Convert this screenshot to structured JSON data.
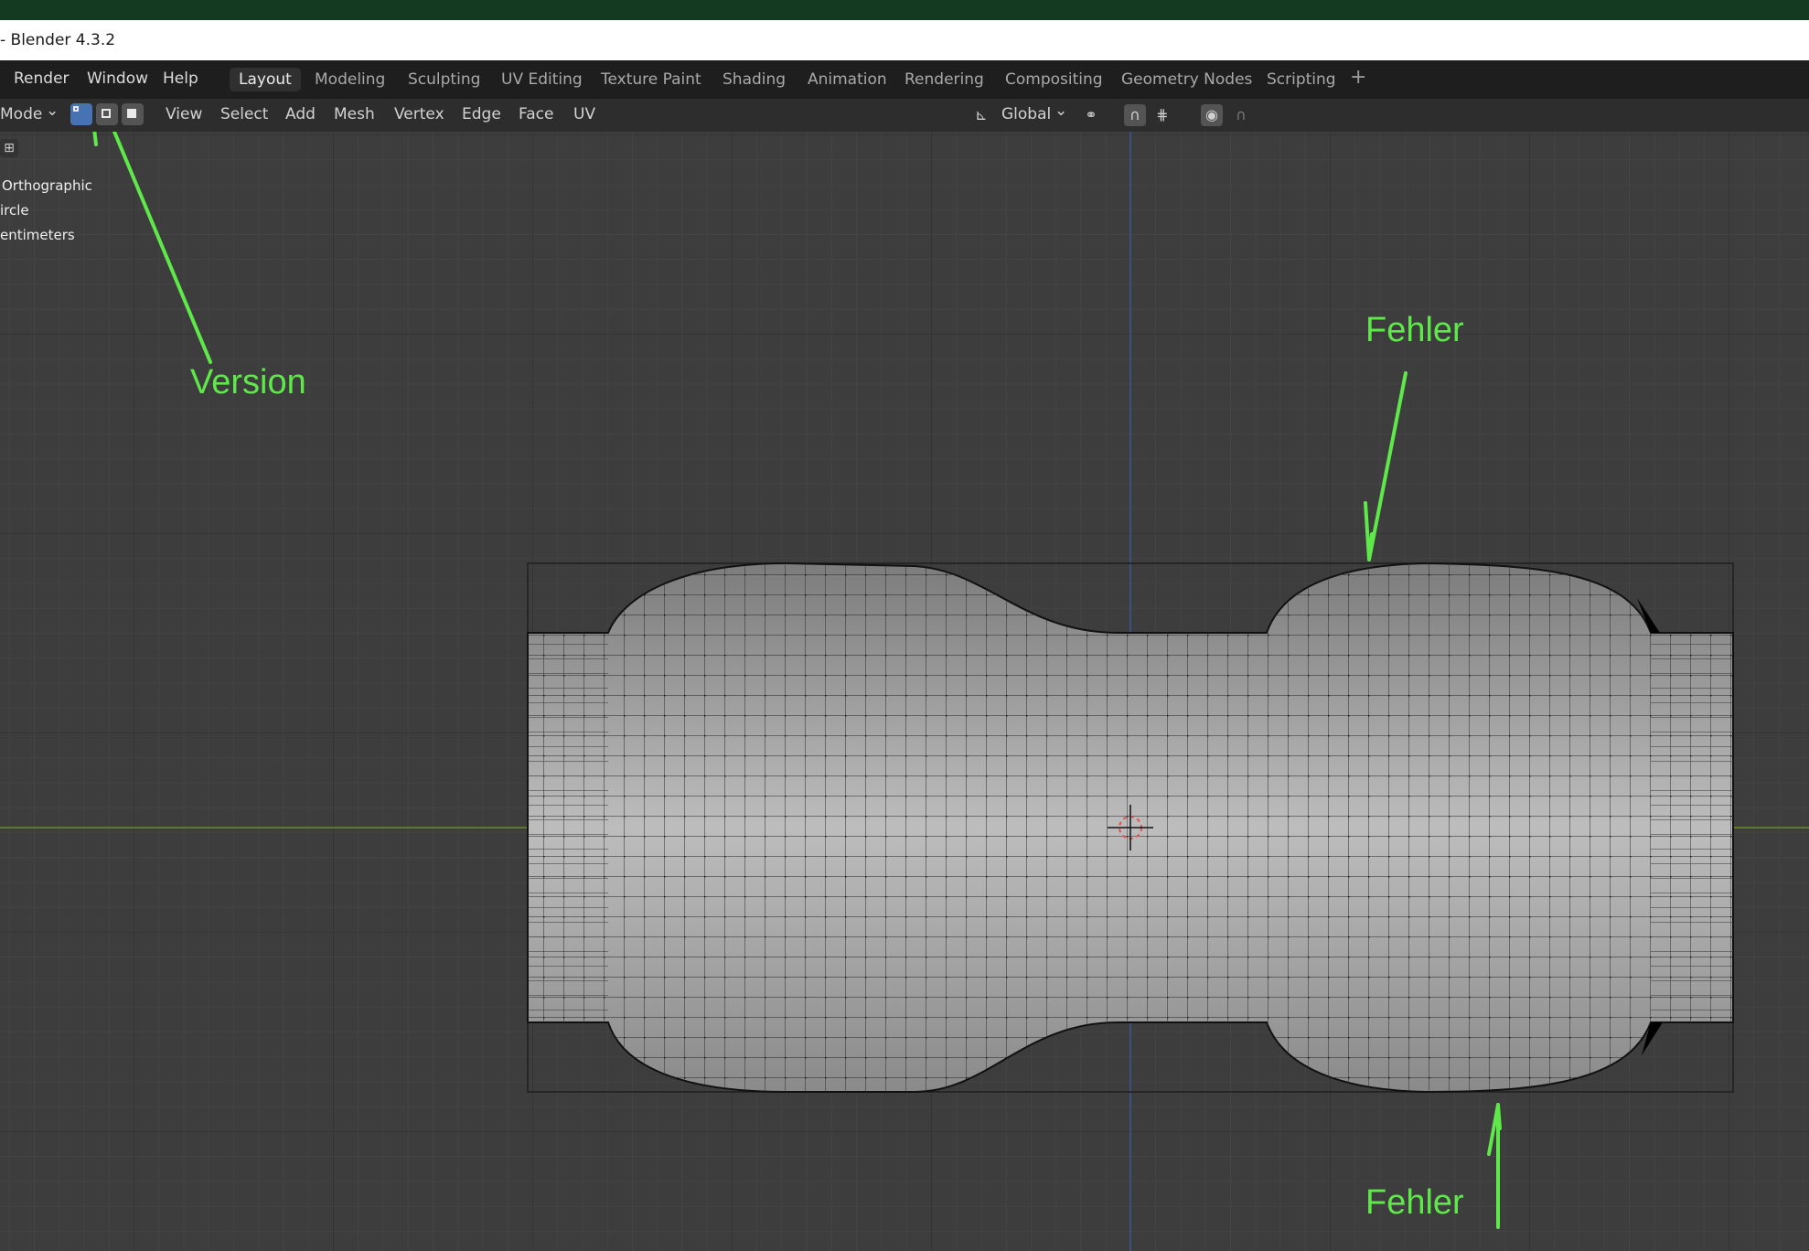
{
  "window": {
    "title": "- Blender 4.3.2"
  },
  "menu": [
    {
      "label": "Render"
    },
    {
      "label": "Window"
    },
    {
      "label": "Help"
    }
  ],
  "workspace_tabs": [
    {
      "label": "Layout",
      "active": true
    },
    {
      "label": "Modeling",
      "active": false
    },
    {
      "label": "Sculpting",
      "active": false
    },
    {
      "label": "UV Editing",
      "active": false
    },
    {
      "label": "Texture Paint",
      "active": false
    },
    {
      "label": "Shading",
      "active": false
    },
    {
      "label": "Animation",
      "active": false
    },
    {
      "label": "Rendering",
      "active": false
    },
    {
      "label": "Compositing",
      "active": false
    },
    {
      "label": "Geometry Nodes",
      "active": false
    },
    {
      "label": "Scripting",
      "active": false
    }
  ],
  "add_workspace": "+",
  "header": {
    "mode_label": "Mode",
    "mode_chevron": "⌄",
    "select_modes": [
      "vertex-select",
      "edge-select",
      "face-select"
    ],
    "menus": [
      "View",
      "Select",
      "Add",
      "Mesh",
      "Vertex",
      "Edge",
      "Face",
      "UV"
    ],
    "orientation": "Global",
    "orientation_chevron": "⌄",
    "transform_icon": "transform-orientation-icon",
    "pivot_icon": "pivot-point-icon",
    "snap_icon": "snap-magnet-icon",
    "snap_target_icon": "snap-increment-icon",
    "proportional_icon": "proportional-editing-icon",
    "falloff_icon": "falloff-curve-icon"
  },
  "viewport_overlay": {
    "lines": [
      "Orthographic",
      "ircle",
      "entimeters"
    ]
  },
  "annotations": {
    "version": "Version",
    "fehler_top": "Fehler",
    "fehler_bottom": "Fehler"
  },
  "colors": {
    "annotation": "#5ee84a",
    "active_tab_bg": "#303030",
    "select_active": "#4772b3",
    "x_axis": "#6a8a2a",
    "z_axis": "#3a5a9a"
  }
}
